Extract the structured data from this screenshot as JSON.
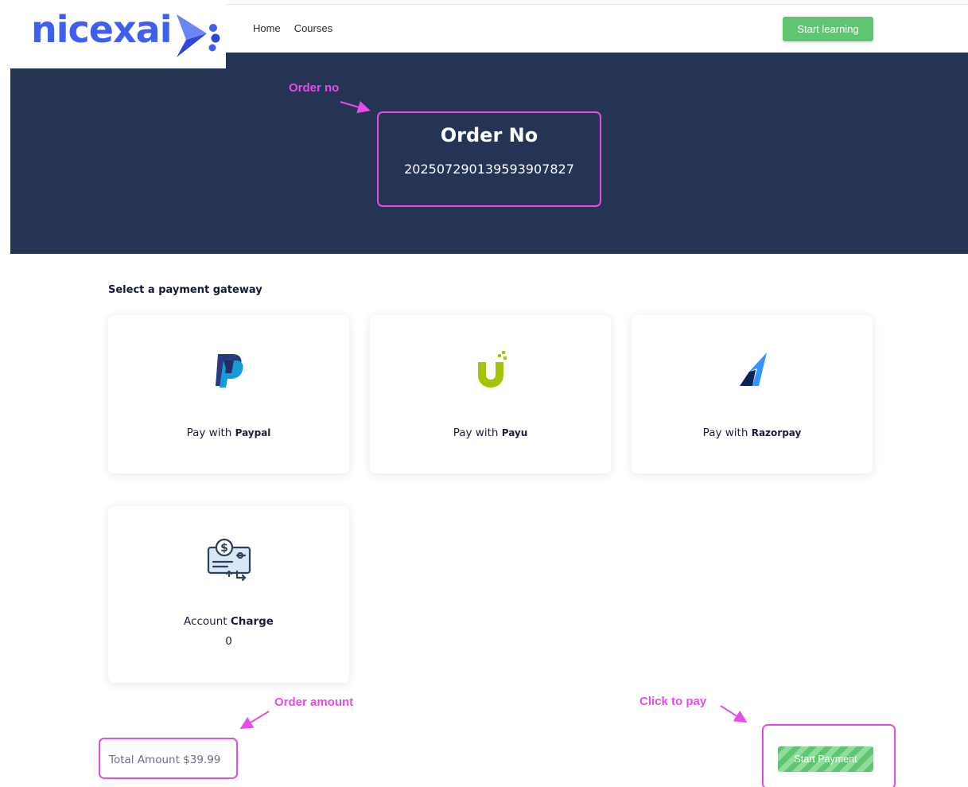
{
  "header": {
    "logo_text": "nicexai",
    "nav": [
      "Home",
      "Courses"
    ],
    "cta_label": "Start learning"
  },
  "order": {
    "title": "Order No",
    "number": "20250729013959390​7827"
  },
  "annotations": {
    "order_no": "Order no",
    "order_amount": "Order amount",
    "click_to_pay": "Click to pay"
  },
  "payment": {
    "heading": "Select a payment gateway",
    "gateways": [
      {
        "prefix": "Pay with",
        "name": "Paypal",
        "icon": "paypal-icon"
      },
      {
        "prefix": "Pay with",
        "name": "Payu",
        "icon": "payu-icon"
      },
      {
        "prefix": "Pay with",
        "name": "Razorpay",
        "icon": "razorpay-icon"
      }
    ],
    "account": {
      "prefix": "Account",
      "name": "Charge",
      "value": "0",
      "icon": "cheque-payment-icon"
    }
  },
  "footer": {
    "total_label": "Total Amount $39.99",
    "pay_button": "Start Payment"
  },
  "colors": {
    "brand_blue": "#3f5fee",
    "hero_bg": "#253355",
    "accent_green": "#5fc571",
    "annotation_magenta": "#e64ce6"
  }
}
